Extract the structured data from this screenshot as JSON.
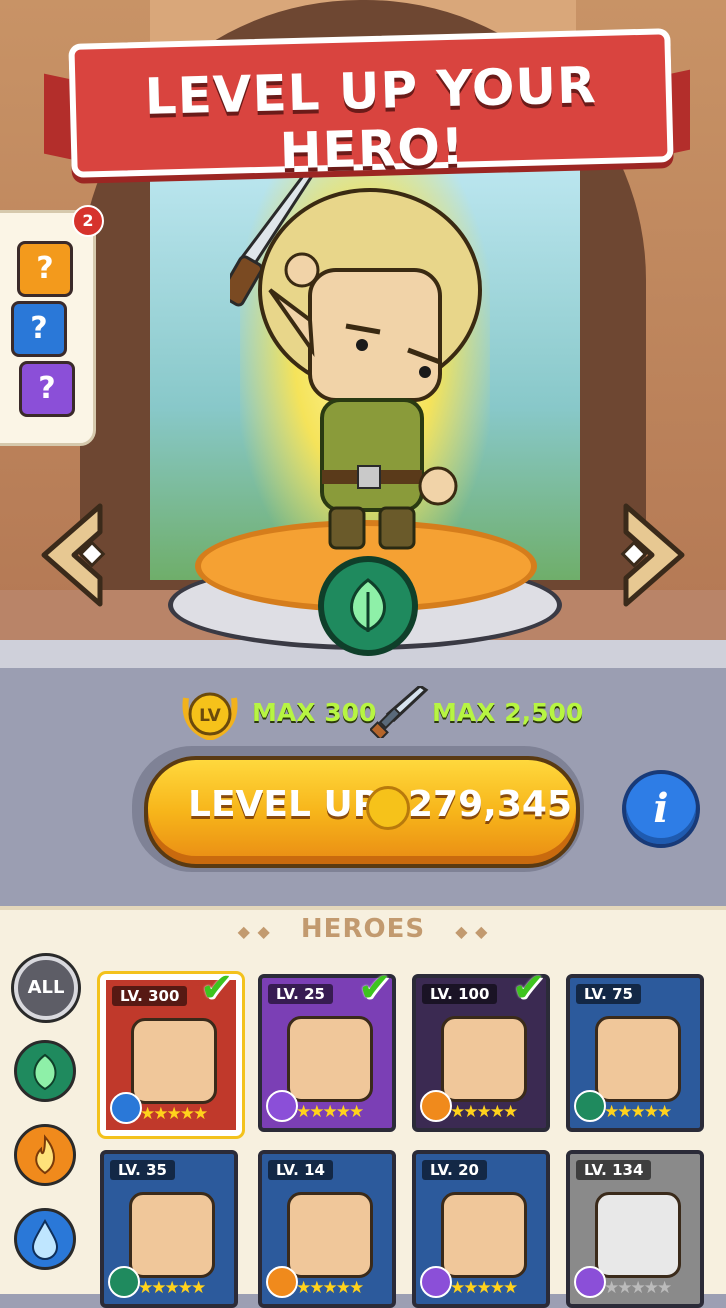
{
  "banner": {
    "title": "LEVEL UP YOUR HERO!"
  },
  "puzzle": {
    "badge_count": "2",
    "pieces": [
      "?",
      "?",
      "?"
    ]
  },
  "stats": {
    "level_icon_text": "LV",
    "max_level": "MAX 300",
    "max_attack": "MAX 2,500"
  },
  "levelup": {
    "label": "LEVEL UP",
    "price": "279,345"
  },
  "info": {
    "label": "i"
  },
  "heroes": {
    "title": "HEROES",
    "filters": [
      {
        "label": "ALL",
        "icon": "all"
      },
      {
        "label": "",
        "icon": "leaf-icon"
      },
      {
        "label": "",
        "icon": "fire-icon"
      },
      {
        "label": "",
        "icon": "water-icon"
      }
    ],
    "cards": [
      {
        "level": "LV. 300",
        "element": "water",
        "stars": "★★★★★",
        "checked": true
      },
      {
        "level": "LV. 25",
        "element": "lightning",
        "stars": "★★★★★",
        "checked": true
      },
      {
        "level": "LV. 100",
        "element": "fire",
        "stars": "★★★★★",
        "checked": true
      },
      {
        "level": "LV. 75",
        "element": "leaf",
        "stars": "★★★★★",
        "checked": false
      },
      {
        "level": "LV. 35",
        "element": "leaf",
        "stars": "★★★★★",
        "checked": false
      },
      {
        "level": "LV. 14",
        "element": "fire",
        "stars": "★★★★★",
        "checked": false
      },
      {
        "level": "LV. 20",
        "element": "lightning",
        "stars": "★★★★★",
        "checked": false
      },
      {
        "level": "LV. 134",
        "element": "lightning",
        "stars": "★★★★★",
        "checked": false
      }
    ]
  },
  "colors": {
    "banner_red": "#d9443f",
    "button_orange": "#f7b51a",
    "stat_green": "#b7f542",
    "info_blue": "#2e7de6",
    "leaf_green": "#1f8a5e",
    "fire_orange": "#f08a1c",
    "water_blue": "#2a78d8",
    "lightning_purple": "#8b4fd8"
  }
}
